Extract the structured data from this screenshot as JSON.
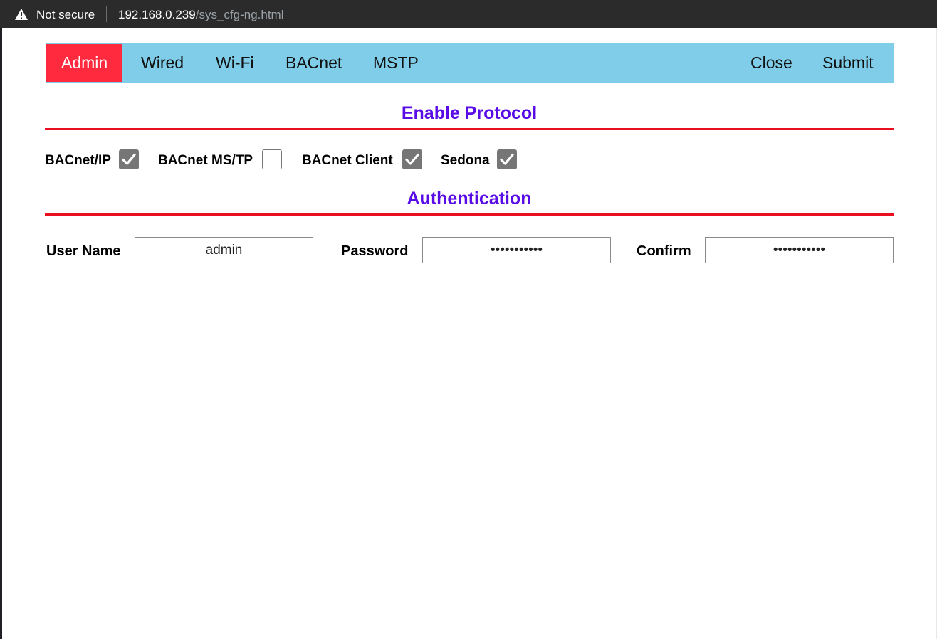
{
  "browser": {
    "security_label": "Not secure",
    "url_host": "192.168.0.239",
    "url_path": "/sys_cfg-ng.html"
  },
  "nav": {
    "tabs": [
      {
        "label": "Admin",
        "active": true
      },
      {
        "label": "Wired",
        "active": false
      },
      {
        "label": "Wi-Fi",
        "active": false
      },
      {
        "label": "BACnet",
        "active": false
      },
      {
        "label": "MSTP",
        "active": false
      }
    ],
    "close_label": "Close",
    "submit_label": "Submit",
    "active_color": "#ff2a3e",
    "bar_color": "#7fcde8"
  },
  "protocol": {
    "title": "Enable Protocol",
    "options": [
      {
        "label": "BACnet/IP",
        "checked": true
      },
      {
        "label": "BACnet MS/TP",
        "checked": false
      },
      {
        "label": "BACnet Client",
        "checked": true
      },
      {
        "label": "Sedona",
        "checked": true
      }
    ]
  },
  "auth": {
    "title": "Authentication",
    "username_label": "User Name",
    "username_value": "admin",
    "password_label": "Password",
    "password_value": "•••••••••••",
    "confirm_label": "Confirm",
    "confirm_value": "•••••••••••"
  },
  "colors": {
    "title": "#5a0ce6",
    "rule": "#e8101e"
  }
}
